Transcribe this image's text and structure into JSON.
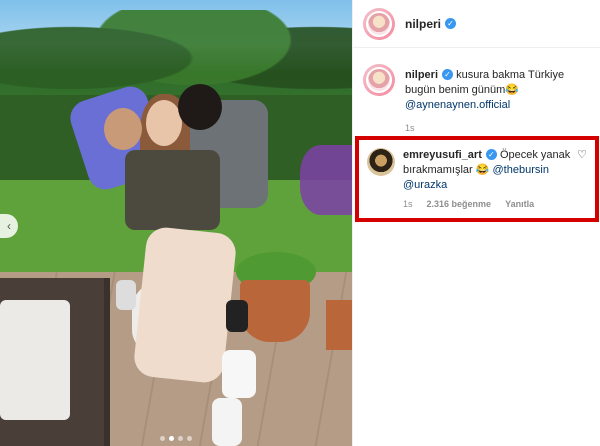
{
  "post": {
    "author": "nilperi",
    "caption_text": "kusura bakma Türkiye bugün benim günüm",
    "caption_emoji": "😂",
    "caption_mention": "@aynenaynen.official",
    "caption_time": "1s"
  },
  "comment": {
    "author": "emreyusufi_art",
    "text": "Öpecek yanak bırakmamışlar",
    "emoji": "😂",
    "mention1": "@thebursin",
    "mention2": "@urazka",
    "time": "1s",
    "likes": "2.316 beğenme",
    "reply_label": "Yanıtla",
    "heart_glyph": "♡"
  },
  "carousel": {
    "prev_glyph": "‹",
    "active_index": 1,
    "count": 4
  },
  "verified_glyph": "✓",
  "colors": {
    "highlight": "#d40000",
    "link": "#00376b",
    "verified": "#3897f0"
  }
}
